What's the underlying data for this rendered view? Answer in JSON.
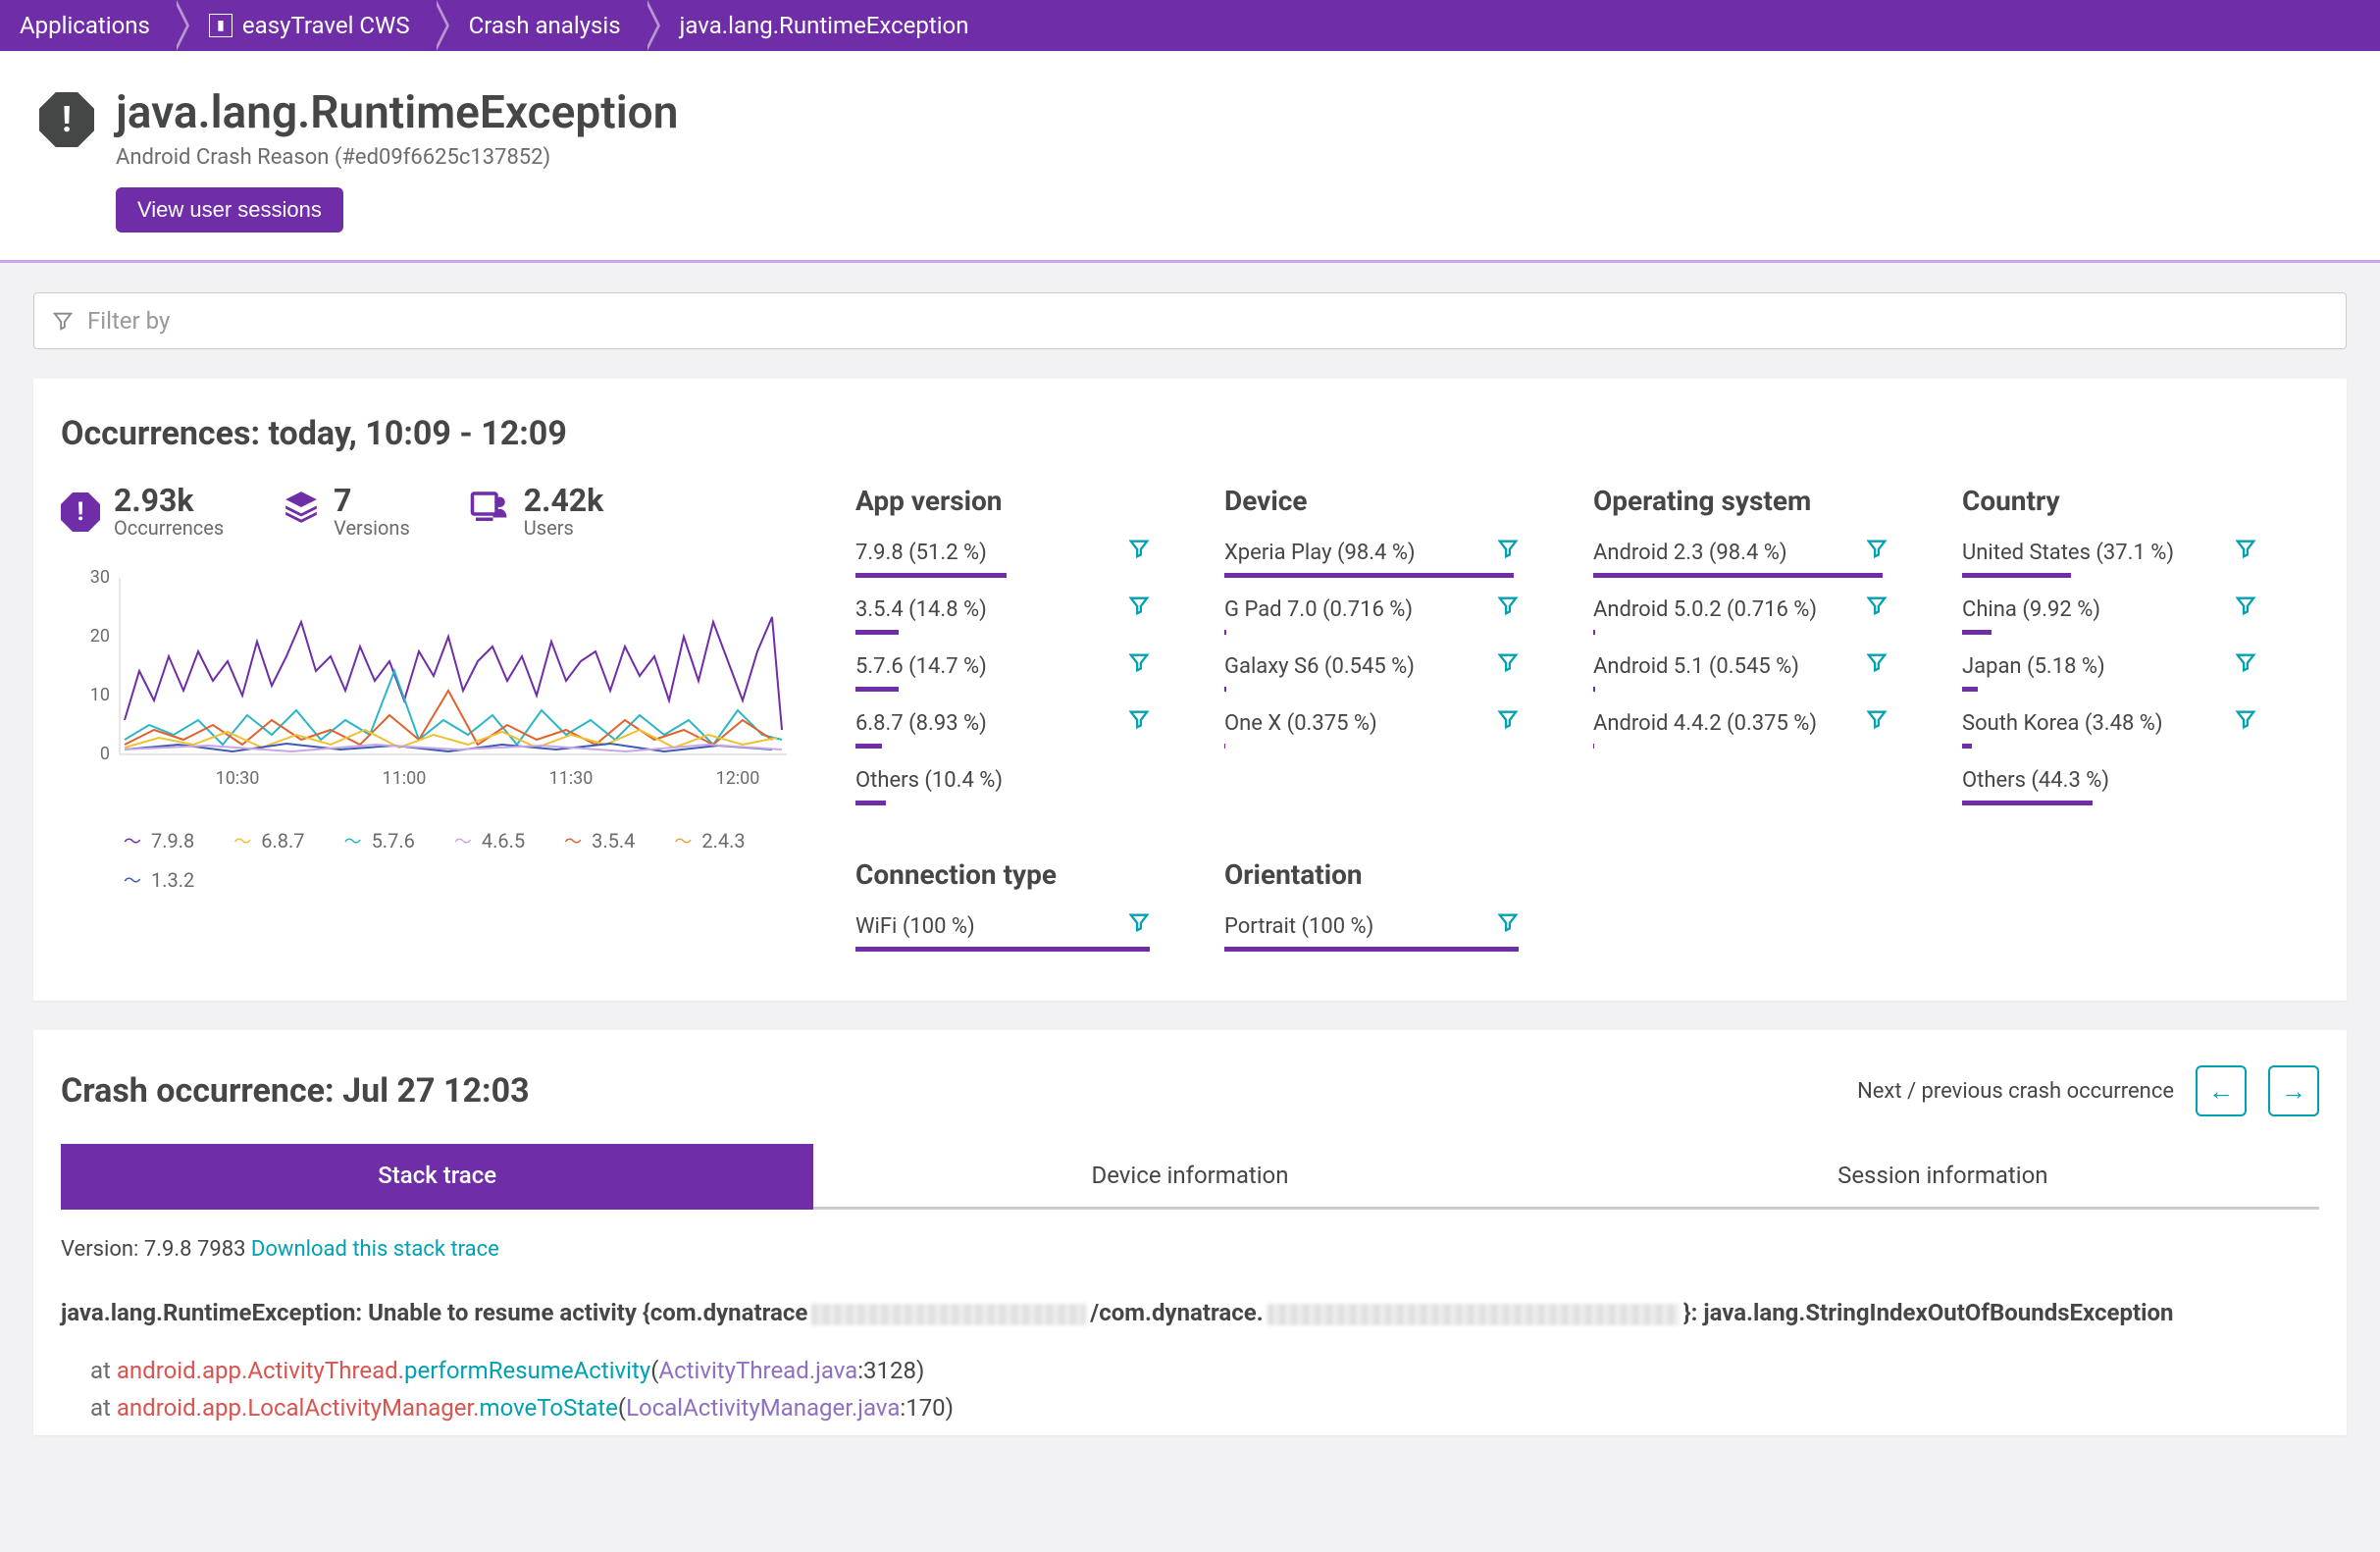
{
  "breadcrumb": {
    "items": [
      {
        "label": "Applications"
      },
      {
        "label": "easyTravel CWS",
        "icon": true
      },
      {
        "label": "Crash analysis"
      },
      {
        "label": "java.lang.RuntimeException"
      }
    ]
  },
  "header": {
    "title": "java.lang.RuntimeException",
    "subtitle": "Android Crash Reason (#ed09f6625c137852)",
    "button": "View user sessions"
  },
  "filter": {
    "placeholder": "Filter by"
  },
  "occurrences": {
    "title": "Occurrences: today, 10:09 - 12:09",
    "stats": [
      {
        "value": "2.93k",
        "label": "Occurrences",
        "icon": "octagon"
      },
      {
        "value": "7",
        "label": "Versions",
        "icon": "stack"
      },
      {
        "value": "2.42k",
        "label": "Users",
        "icon": "users"
      }
    ],
    "xticks": [
      "10:30",
      "11:00",
      "11:30",
      "12:00"
    ],
    "yticks": [
      "0",
      "10",
      "20",
      "30"
    ],
    "legend": [
      {
        "label": "7.9.8",
        "color": "#6f2da8"
      },
      {
        "label": "6.8.7",
        "color": "#f0c02e"
      },
      {
        "label": "5.7.6",
        "color": "#2ab6c7"
      },
      {
        "label": "4.6.5",
        "color": "#c9a6e4"
      },
      {
        "label": "3.5.4",
        "color": "#e0622f"
      },
      {
        "label": "2.4.3",
        "color": "#e9a23b"
      },
      {
        "label": "1.3.2",
        "color": "#3b5bb5"
      }
    ],
    "groups": {
      "appVersion": {
        "title": "App version",
        "items": [
          {
            "label": "7.9.8 (51.2 %)",
            "pct": 51.2,
            "filter": true
          },
          {
            "label": "3.5.4 (14.8 %)",
            "pct": 14.8,
            "filter": true
          },
          {
            "label": "5.7.6 (14.7 %)",
            "pct": 14.7,
            "filter": true
          },
          {
            "label": "6.8.7 (8.93 %)",
            "pct": 8.93,
            "filter": true
          },
          {
            "label": "Others (10.4 %)",
            "pct": 10.4,
            "filter": false
          }
        ]
      },
      "device": {
        "title": "Device",
        "items": [
          {
            "label": "Xperia Play (98.4 %)",
            "pct": 98.4,
            "filter": true
          },
          {
            "label": "G Pad 7.0 (0.716 %)",
            "pct": 0.716,
            "filter": true
          },
          {
            "label": "Galaxy S6 (0.545 %)",
            "pct": 0.545,
            "filter": true
          },
          {
            "label": "One X (0.375 %)",
            "pct": 0.375,
            "filter": true
          }
        ]
      },
      "os": {
        "title": "Operating system",
        "items": [
          {
            "label": "Android 2.3 (98.4 %)",
            "pct": 98.4,
            "filter": true
          },
          {
            "label": "Android 5.0.2 (0.716 %)",
            "pct": 0.716,
            "filter": true
          },
          {
            "label": "Android 5.1 (0.545 %)",
            "pct": 0.545,
            "filter": true
          },
          {
            "label": "Android 4.4.2 (0.375 %)",
            "pct": 0.375,
            "filter": true
          }
        ]
      },
      "country": {
        "title": "Country",
        "items": [
          {
            "label": "United States (37.1 %)",
            "pct": 37.1,
            "filter": true
          },
          {
            "label": "China (9.92 %)",
            "pct": 9.92,
            "filter": true
          },
          {
            "label": "Japan (5.18 %)",
            "pct": 5.18,
            "filter": true
          },
          {
            "label": "South Korea (3.48 %)",
            "pct": 3.48,
            "filter": true
          },
          {
            "label": "Others (44.3 %)",
            "pct": 44.3,
            "filter": false
          }
        ]
      },
      "connection": {
        "title": "Connection type",
        "items": [
          {
            "label": "WiFi (100 %)",
            "pct": 100,
            "filter": true
          }
        ]
      },
      "orientation": {
        "title": "Orientation",
        "items": [
          {
            "label": "Portrait (100 %)",
            "pct": 100,
            "filter": true
          }
        ]
      }
    }
  },
  "crash": {
    "title": "Crash occurrence: Jul 27 12:03",
    "navLabel": "Next / previous crash occurrence",
    "tabs": [
      "Stack trace",
      "Device information",
      "Session information"
    ],
    "activeTab": 0,
    "versionLabel": "Version: 7.9.8 7983 ",
    "downloadLabel": "Download this stack trace",
    "exception": {
      "pre": "java.lang.RuntimeException: Unable to resume activity {com.dynatrace",
      "mid": "/com.dynatrace.",
      "post": "}: java.lang.StringIndexOutOfBoundsException"
    },
    "stack": [
      {
        "at": "at  ",
        "pkg": "android.app.ActivityThread.",
        "method": "performResumeActivity",
        "open": "(",
        "file": "ActivityThread.java",
        "line": ":3128)"
      },
      {
        "at": "at  ",
        "pkg": "android.app.LocalActivityManager.",
        "method": "moveToState",
        "open": "(",
        "file": "LocalActivityManager.java",
        "line": ":170)"
      }
    ]
  },
  "chart_data": {
    "type": "line",
    "xrange": [
      "10:09",
      "12:09"
    ],
    "xticks": [
      "10:30",
      "11:00",
      "11:30",
      "12:00"
    ],
    "ylim": [
      0,
      30
    ],
    "yticks": [
      0,
      10,
      20,
      30
    ],
    "ylabel": "",
    "xlabel": "",
    "title": "",
    "series": [
      {
        "name": "7.9.8",
        "color": "#6f2da8",
        "approx_range": [
          5,
          25
        ],
        "note": "dominant noisy line, peaks ~22-25"
      },
      {
        "name": "6.8.7",
        "color": "#f0c02e",
        "approx_range": [
          0,
          10
        ]
      },
      {
        "name": "5.7.6",
        "color": "#2ab6c7",
        "approx_range": [
          0,
          13
        ]
      },
      {
        "name": "4.6.5",
        "color": "#c9a6e4",
        "approx_range": [
          0,
          6
        ]
      },
      {
        "name": "3.5.4",
        "color": "#e0622f",
        "approx_range": [
          0,
          12
        ]
      },
      {
        "name": "2.4.3",
        "color": "#e9a23b",
        "approx_range": [
          0,
          7
        ]
      },
      {
        "name": "1.3.2",
        "color": "#3b5bb5",
        "approx_range": [
          0,
          5
        ]
      }
    ]
  }
}
